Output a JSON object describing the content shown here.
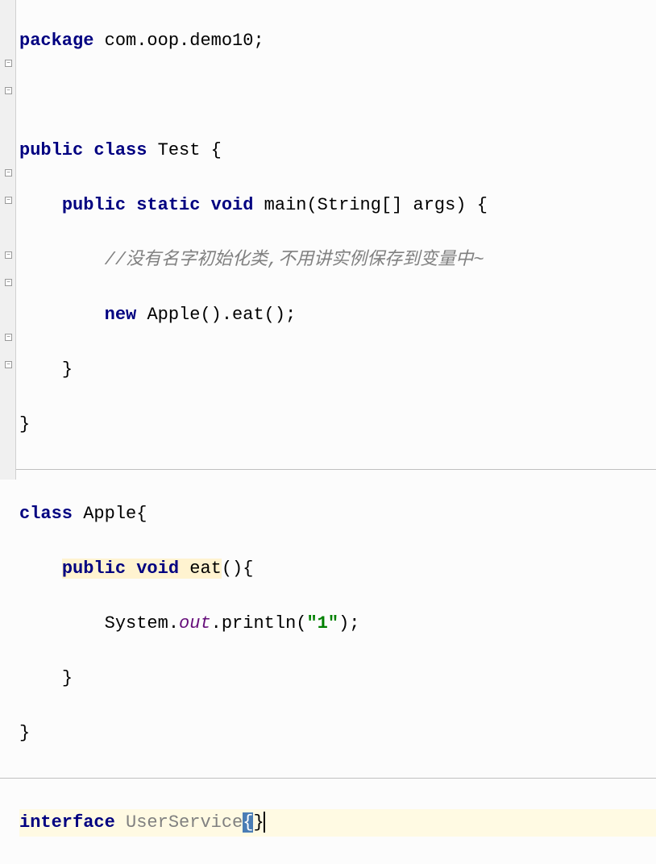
{
  "code": {
    "line1": {
      "kw_package": "package",
      "pkg_name": "com.oop.demo10",
      "semi": ";"
    },
    "line3": {
      "kw_public": "public",
      "kw_class": "class",
      "class_name": "Test",
      "brace": "{"
    },
    "line4": {
      "kw_public": "public",
      "kw_static": "static",
      "kw_void": "void",
      "method_sig": "main(String[] args) {"
    },
    "line5": {
      "comment": "//没有名字初始化类,不用讲实例保存到变量中~"
    },
    "line6": {
      "kw_new": "new",
      "expr": "Apple().eat();"
    },
    "line7": {
      "brace": "}"
    },
    "line8": {
      "brace": "}"
    },
    "line10": {
      "kw_class": "class",
      "class_name": "Apple",
      "brace": "{"
    },
    "line11": {
      "kw_public": "public",
      "kw_void": "void",
      "method_name": "eat",
      "paren_brace": "(){"
    },
    "line12": {
      "sys": "System.",
      "out": "out",
      "println": ".println(",
      "str": "\"1\"",
      "end": ");"
    },
    "line13": {
      "brace": "}"
    },
    "line14": {
      "brace": "}"
    },
    "line16": {
      "kw_interface": "interface",
      "iface_name": "UserService",
      "brace_open": "{",
      "brace_close": "}"
    }
  }
}
